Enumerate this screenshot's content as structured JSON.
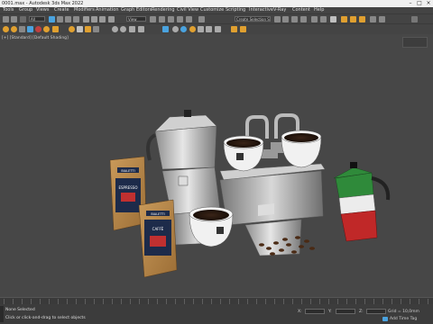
{
  "window": {
    "title": "0001.max - Autodesk 3ds Max 2022"
  },
  "menu": [
    "Tools",
    "Group",
    "Views",
    "Create",
    "Modifiers",
    "Animation",
    "Graph Editors",
    "Rendering",
    "Civil View",
    "Customize",
    "Scripting",
    "Interactive",
    "V-Ray",
    "Content",
    "Help"
  ],
  "toolbar": {
    "selection_filter": "All",
    "view_dropdown": "View",
    "selection_set": "Create Selection Se"
  },
  "viewport": {
    "label": "[+] [Standard] [Default Shading]"
  },
  "scene": {
    "bag_brand": "BIALETTI",
    "bag_product": "ESPRESSO",
    "bag_type": "CAFFÈ"
  },
  "status": {
    "line1": "None Selected",
    "line2": "Click or click-and-drag to select objects",
    "x_label": "X:",
    "y_label": "Y:",
    "z_label": "Z:",
    "grid": "Grid = 10,0mm",
    "add_time_tag": "Add Time Tag"
  },
  "colors": {
    "viewport_bg": "#474747",
    "ui_bg": "#444444",
    "accent": "#4aa3df"
  }
}
